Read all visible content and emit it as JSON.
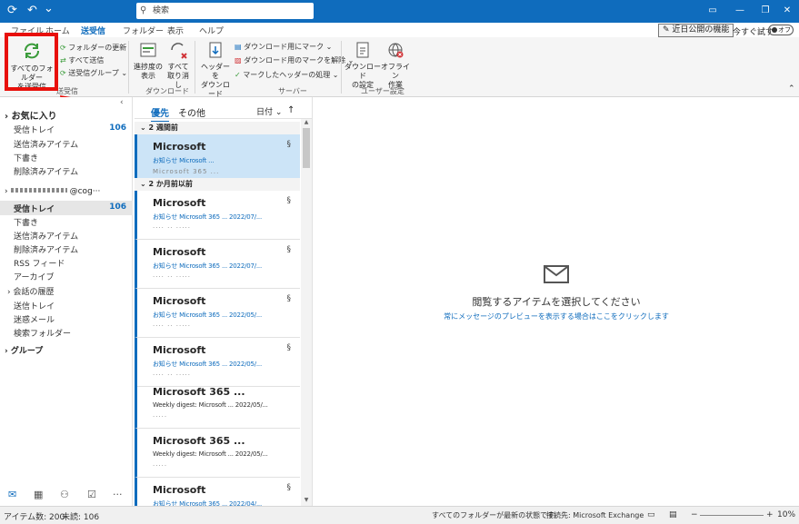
{
  "titlebar": {
    "search_placeholder": "検索",
    "sync_icon": "⟳",
    "undo_icon": "↶",
    "menu_icon": "⌄"
  },
  "menu": {
    "tabs": [
      "ファイル",
      "ホーム",
      "送受信",
      "フォルダー",
      "表示",
      "ヘルプ"
    ],
    "new_features": "近日公開の機能",
    "try_now": "今すぐ試す",
    "toggle_state": "オフ"
  },
  "ribbon": {
    "send_receive_all": "すべてのフォルダー\nを送受信",
    "send_receive_all_l1": "すべてのフォルダー",
    "send_receive_all_l2": "を送受信",
    "update_folder": "フォルダーの更新",
    "send_all": "すべて送信",
    "send_receive_groups": "送受信グループ",
    "group_send_receive": "送受信",
    "show_progress_l1": "進捗度の",
    "show_progress_l2": "表示",
    "cancel_all_l1": "すべて",
    "cancel_all_l2": "取り消し",
    "group_download": "ダウンロード",
    "download_headers_l1": "ヘッダーを",
    "download_headers_l2": "ダウンロード",
    "mark_download": "ダウンロード用にマーク",
    "unmark_download": "ダウンロード用のマークを解除",
    "process_marked": "マークしたヘッダーの処理",
    "group_server": "サーバー",
    "download_settings_l1": "ダウンロード",
    "download_settings_l2": "の設定",
    "offline_l1": "オフライン",
    "offline_l2": "作業",
    "group_user_settings": "ユーザー設定"
  },
  "sidebar": {
    "favorites_header": "お気に入り",
    "favorites": [
      {
        "label": "受信トレイ",
        "count": "106"
      },
      {
        "label": "送信済みアイテム",
        "count": ""
      },
      {
        "label": "下書き",
        "count": ""
      },
      {
        "label": "削除済みアイテム",
        "count": ""
      }
    ],
    "account_header": "@cog···",
    "account_items": [
      {
        "label": "受信トレイ",
        "count": "106"
      },
      {
        "label": "下書き",
        "count": ""
      },
      {
        "label": "送信済みアイテム",
        "count": ""
      },
      {
        "label": "削除済みアイテム",
        "count": ""
      },
      {
        "label": "RSS フィード",
        "count": ""
      },
      {
        "label": "アーカイブ",
        "count": ""
      },
      {
        "label": "会話の履歴",
        "count": ""
      },
      {
        "label": "送信トレイ",
        "count": ""
      },
      {
        "label": "迷惑メール",
        "count": ""
      },
      {
        "label": "検索フォルダー",
        "count": ""
      }
    ],
    "groups_header": "グループ"
  },
  "msglist": {
    "tab_focused": "優先",
    "tab_other": "その他",
    "sort_label": "日付",
    "group_2weeks": "2 週間前",
    "group_2months": "2 か月前以前",
    "messages": [
      {
        "sender": "Microsoft",
        "date": "お知らせ Microsoft ...",
        "preview": "Microsoft 365 ..."
      },
      {
        "sender": "Microsoft",
        "date": "お知らせ Microsoft 365 ... 2022/07/...",
        "preview": "···· ·· ·····"
      },
      {
        "sender": "Microsoft",
        "date": "お知らせ Microsoft 365 ... 2022/07/...",
        "preview": "···· ·· ·····"
      },
      {
        "sender": "Microsoft",
        "date": "お知らせ Microsoft 365 ... 2022/05/...",
        "preview": "···· ·· ·····"
      },
      {
        "sender": "Microsoft",
        "date": "お知らせ Microsoft 365 ... 2022/05/...",
        "preview": "···· ·· ·····"
      },
      {
        "sender": "Microsoft 365 ...",
        "date": "Weekly digest: Microsoft ... 2022/05/...",
        "preview": "·····"
      },
      {
        "sender": "Microsoft 365 ...",
        "date": "Weekly digest: Microsoft ... 2022/05/...",
        "preview": "·····"
      },
      {
        "sender": "Microsoft",
        "date": "お知らせ Microsoft 365 ... 2022/04/...",
        "preview": "···· ·· ·····"
      }
    ]
  },
  "reading": {
    "title": "閲覧するアイテムを選択してください",
    "link": "常にメッセージのプレビューを表示する場合はここをクリックします"
  },
  "status": {
    "items": "アイテム数: 200",
    "unread": "未読: 106",
    "folders_state": "すべてのフォルダーが最新の状態です。",
    "connection": "接続先: Microsoft Exchange",
    "zoom": "10%"
  },
  "colors": {
    "accent": "#0f6cbd",
    "highlight": "#e8100b"
  }
}
